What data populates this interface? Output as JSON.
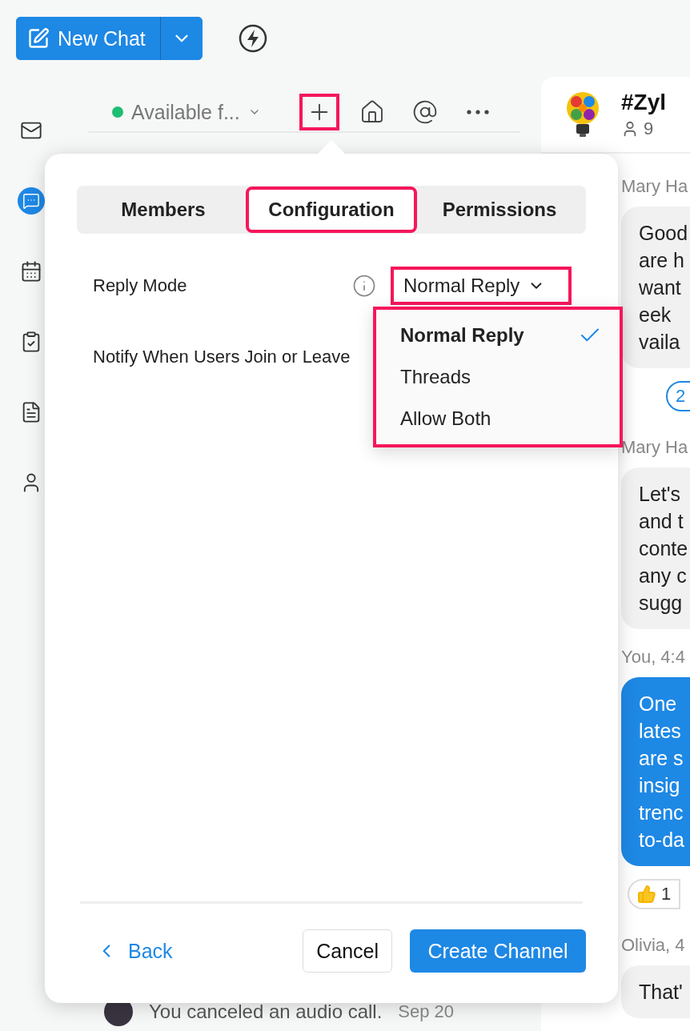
{
  "toolbar": {
    "new_chat": "New Chat"
  },
  "rail": [
    {
      "kind": "mail",
      "selected": false
    },
    {
      "kind": "chat",
      "selected": true
    },
    {
      "kind": "calendar",
      "selected": false
    },
    {
      "kind": "tasks",
      "selected": false
    },
    {
      "kind": "notes",
      "selected": false
    },
    {
      "kind": "contacts",
      "selected": false
    }
  ],
  "status": {
    "label": "Available f..."
  },
  "actions": [
    {
      "kind": "plus",
      "annotated": true
    },
    {
      "kind": "home",
      "annotated": false
    },
    {
      "kind": "at",
      "annotated": false
    },
    {
      "kind": "more",
      "annotated": false
    }
  ],
  "chat_list": [
    {
      "text": "You canceled an audio call.",
      "date": "Sep 20"
    }
  ],
  "channel": {
    "name": "#Zyl",
    "members": "9"
  },
  "messages": [
    {
      "kind": "label",
      "text": "Mary Ha"
    },
    {
      "kind": "bubble",
      "mine": false,
      "lines": [
        "Good",
        "are h",
        "want",
        "eek",
        "vaila"
      ]
    },
    {
      "kind": "reaction",
      "count": "2"
    },
    {
      "kind": "label",
      "text": "Mary Ha"
    },
    {
      "kind": "bubble",
      "mine": false,
      "lines": [
        "Let's",
        "and t",
        "conte",
        "any c",
        "sugg"
      ]
    },
    {
      "kind": "label",
      "text": "You,  4:4"
    },
    {
      "kind": "bubble",
      "mine": true,
      "lines": [
        "One",
        "lates",
        "are s",
        "insig",
        "trenc",
        "to-da"
      ]
    },
    {
      "kind": "like",
      "count": "1"
    },
    {
      "kind": "label",
      "text": "Olivia,  4"
    },
    {
      "kind": "bubble",
      "mine": false,
      "lines": [
        "That'"
      ]
    }
  ],
  "dialog": {
    "tabs": [
      {
        "label": "Members",
        "selected": false,
        "annotated": false
      },
      {
        "label": "Configuration",
        "selected": true,
        "annotated": true
      },
      {
        "label": "Permissions",
        "selected": false,
        "annotated": false
      }
    ],
    "settings": [
      {
        "kind": "dropdown",
        "label": "Reply Mode",
        "value": "Normal Reply",
        "annotated": true
      },
      {
        "kind": "plain",
        "label": "Notify When Users Join or Leave"
      }
    ],
    "menu": {
      "annotated": true,
      "options": [
        {
          "label": "Normal Reply",
          "selected": true
        },
        {
          "label": "Threads",
          "selected": false
        },
        {
          "label": "Allow Both",
          "selected": false
        }
      ]
    },
    "back": "Back",
    "cancel": "Cancel",
    "create": "Create Channel"
  }
}
